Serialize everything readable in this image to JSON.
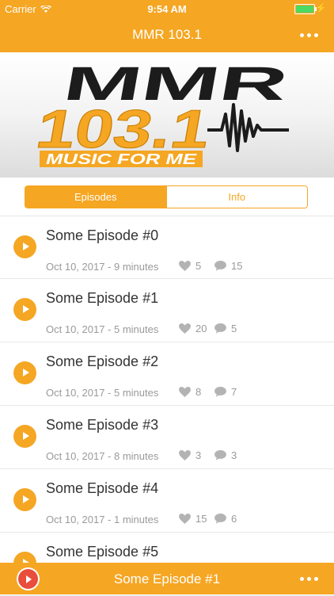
{
  "status": {
    "carrier": "Carrier",
    "time": "9:54 AM"
  },
  "nav": {
    "title": "MMR 103.1"
  },
  "banner": {
    "logo_top": "MMR",
    "logo_number": "103.1",
    "tagline": "MUSIC FOR ME"
  },
  "tabs": [
    {
      "label": "Episodes",
      "active": true
    },
    {
      "label": "Info",
      "active": false
    }
  ],
  "episodes": [
    {
      "title": "Some Episode #0",
      "meta": "Oct 10, 2017 - 9 minutes",
      "likes": "5",
      "comments": "15"
    },
    {
      "title": "Some Episode #1",
      "meta": "Oct 10, 2017 - 5 minutes",
      "likes": "20",
      "comments": "5"
    },
    {
      "title": "Some Episode #2",
      "meta": "Oct 10, 2017 - 5 minutes",
      "likes": "8",
      "comments": "7"
    },
    {
      "title": "Some Episode #3",
      "meta": "Oct 10, 2017 - 8 minutes",
      "likes": "3",
      "comments": "3"
    },
    {
      "title": "Some Episode #4",
      "meta": "Oct 10, 2017 - 1 minutes",
      "likes": "15",
      "comments": "6"
    },
    {
      "title": "Some Episode #5"
    }
  ],
  "player": {
    "now_playing": "Some Episode #1"
  },
  "colors": {
    "accent": "#f5a623",
    "play_red": "#e94e3c",
    "text": "#333333",
    "muted": "#9a9a9a"
  }
}
